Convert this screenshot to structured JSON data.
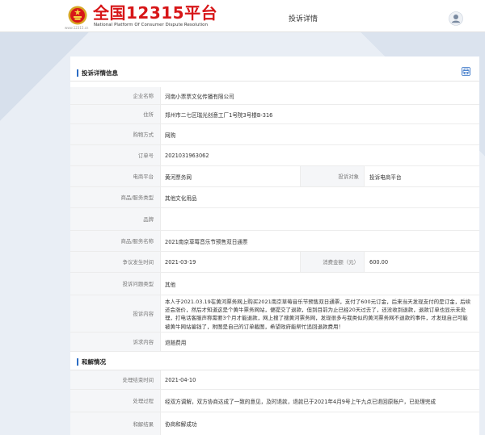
{
  "header": {
    "site_url": "www.12315.cn",
    "logo_title": "全国12315平台",
    "logo_subtitle": "National Platform Of Consumer Dispute Resolution",
    "page_heading": "投诉详情",
    "brand_color": "#d71618"
  },
  "complaint": {
    "section_title": "投诉详情信息",
    "rows": [
      {
        "label": "企业名称",
        "value": "河南小票票文化传播有限公司"
      },
      {
        "label": "住所",
        "value": "郑州市二七区瑞光创意工厂1号院3号楼B-316"
      },
      {
        "label": "购物方式",
        "value": "网购"
      },
      {
        "label": "订单号",
        "value": "2021031963062"
      },
      {
        "label": "电商平台",
        "value": "黄河票务网",
        "label2": "投诉对象",
        "value2": "投诉电商平台"
      },
      {
        "label": "商品/服务类型",
        "value": "其他文化用品"
      },
      {
        "label": "品牌",
        "value": ""
      },
      {
        "label": "商品/服务名称",
        "value": "2021南京草莓音乐节预售双日通票"
      },
      {
        "label": "争议发生时间",
        "value": "2021-03-19",
        "label2": "消费金额（元）",
        "value2": "600.00"
      },
      {
        "label": "投诉问题类型",
        "value": "其他"
      },
      {
        "label": "投诉内容",
        "value": "本人于2021.03.19在黄河票务网上购买2021南京草莓音乐节预售双日通票，支付了600元订金，后来当天发现支付的是订金，后续还会涨价，然后才知道这是个黄牛票务网站，便提交了退款，但到目前为止已经20天过去了，还没收到退款，退款订单也显示未处理，打电话客服声称需要3个月才能退款，网上搜了搜黄河票务网，发现很多与我类似的黄河票务网不退款的事件，才发现自己可能被黄牛网站骗钱了，附图是自己的订单截图，希望政府能帮忙追回退款费用！"
      },
      {
        "label": "诉求内容",
        "value": "退赔费用"
      }
    ]
  },
  "settlement": {
    "section_title": "和解情况",
    "rows": [
      {
        "label": "处理结束时间",
        "value": "2021-04-10"
      },
      {
        "label": "处理过程",
        "value": "经双方调解，双方协商达成了一致的意见，及时退款，退款已于2021年4月9号上午九点已退回原账户，已处理完成"
      },
      {
        "label": "和解结果",
        "value": "协商和解成功"
      }
    ]
  }
}
